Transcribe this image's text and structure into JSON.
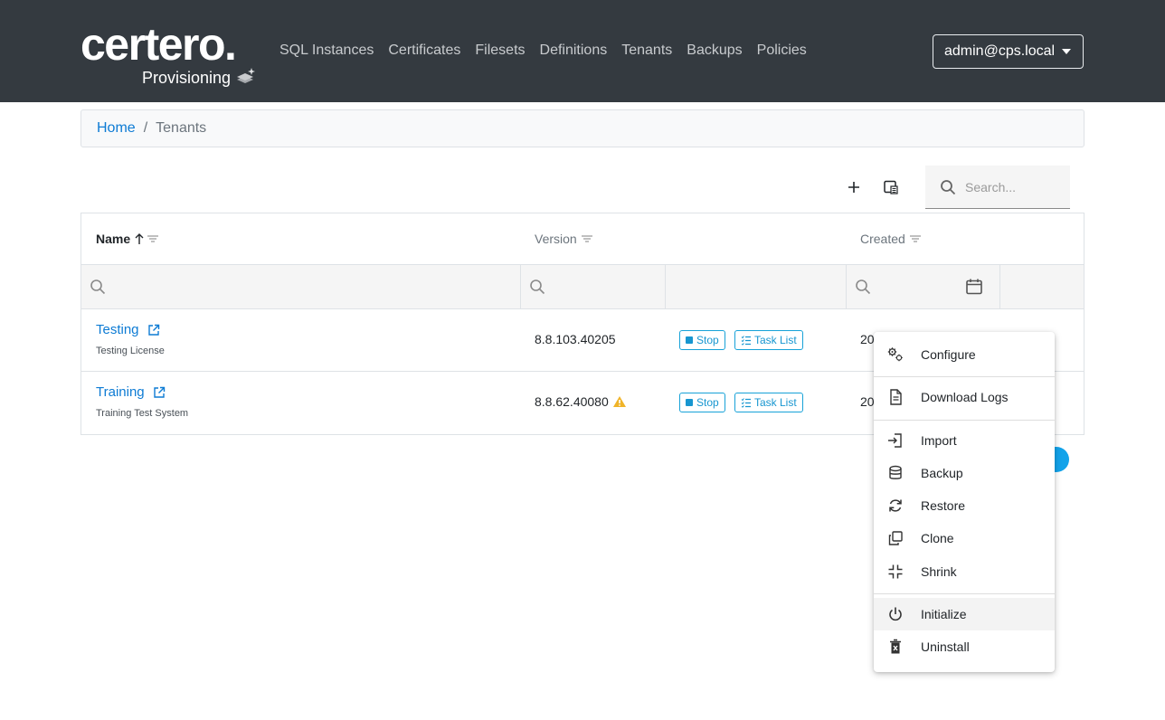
{
  "brand": {
    "name": "certero.",
    "product": "Provisioning"
  },
  "nav": [
    "SQL Instances",
    "Certificates",
    "Filesets",
    "Definitions",
    "Tenants",
    "Backups",
    "Policies"
  ],
  "user": {
    "label": "admin@cps.local"
  },
  "breadcrumb": {
    "home": "Home",
    "separator": "/",
    "current": "Tenants"
  },
  "toolbar": {
    "search_placeholder": "Search..."
  },
  "table": {
    "columns": {
      "name": "Name",
      "version": "Version",
      "created": "Created"
    },
    "rows": [
      {
        "name": "Testing",
        "description": "Testing License",
        "version": "8.8.103.40205",
        "stop": "Stop",
        "tasks": "Task List",
        "created": "20"
      },
      {
        "name": "Training",
        "description": "Training Test System",
        "version": "8.8.62.40080",
        "stop": "Stop",
        "tasks": "Task List",
        "created": "20"
      }
    ]
  },
  "menu": {
    "items": [
      "Configure",
      "Download Logs",
      "Import",
      "Backup",
      "Restore",
      "Clone",
      "Shrink",
      "Initialize",
      "Uninstall"
    ]
  },
  "colors": {
    "navbar": "#343a40",
    "link": "#0d7bd4",
    "accent": "#13a3ea",
    "warning": "#f0b429"
  }
}
